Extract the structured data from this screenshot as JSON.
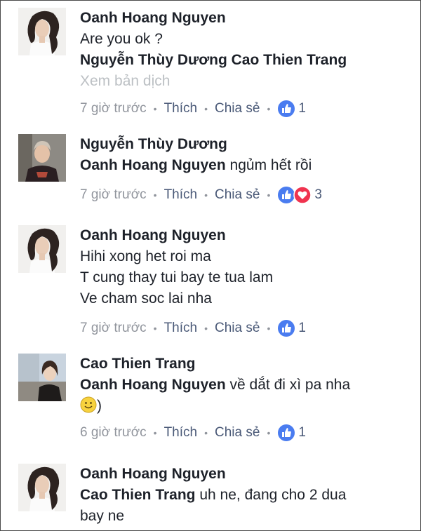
{
  "comments": [
    {
      "author": "Oanh Hoang Nguyen",
      "line1": "Are you ok ?",
      "line2_mention": "Nguyễn Thùy Dương Cao Thien Trang",
      "translate": "Xem bản dịch",
      "time": "7 giờ trước",
      "like": "Thích",
      "share": "Chia sẻ",
      "count": "1"
    },
    {
      "author": "Nguyễn Thùy Dương",
      "mention": "Oanh Hoang Nguyen",
      "text": "ngủm hết rồi",
      "time": "7 giờ trước",
      "like": "Thích",
      "share": "Chia sẻ",
      "count": "3"
    },
    {
      "author": "Oanh Hoang Nguyen",
      "line1": "Hihi xong het roi ma",
      "line2": "T cung thay tui bay te tua lam",
      "line3": "Ve cham soc lai nha",
      "time": "7 giờ trước",
      "like": "Thích",
      "share": "Chia sẻ",
      "count": "1"
    },
    {
      "author": "Cao Thien Trang",
      "mention": "Oanh Hoang Nguyen",
      "text": "về dắt đi xì pa nha",
      "line2": ")",
      "time": "6 giờ trước",
      "like": "Thích",
      "share": "Chia sẻ",
      "count": "1"
    },
    {
      "author": "Oanh Hoang Nguyen",
      "mention": "Cao Thien Trang",
      "text": "uh ne, đang cho 2 dua",
      "line2": "bay ne"
    }
  ],
  "colors": {
    "like_blue": "#4a7cf0",
    "love_red": "#f0334f",
    "meta_gray": "#90949c",
    "link_slate": "#4b5a78"
  },
  "icons": {
    "like": "like-thumb-icon",
    "love": "love-heart-icon",
    "smile": "smile-emoji-icon"
  }
}
